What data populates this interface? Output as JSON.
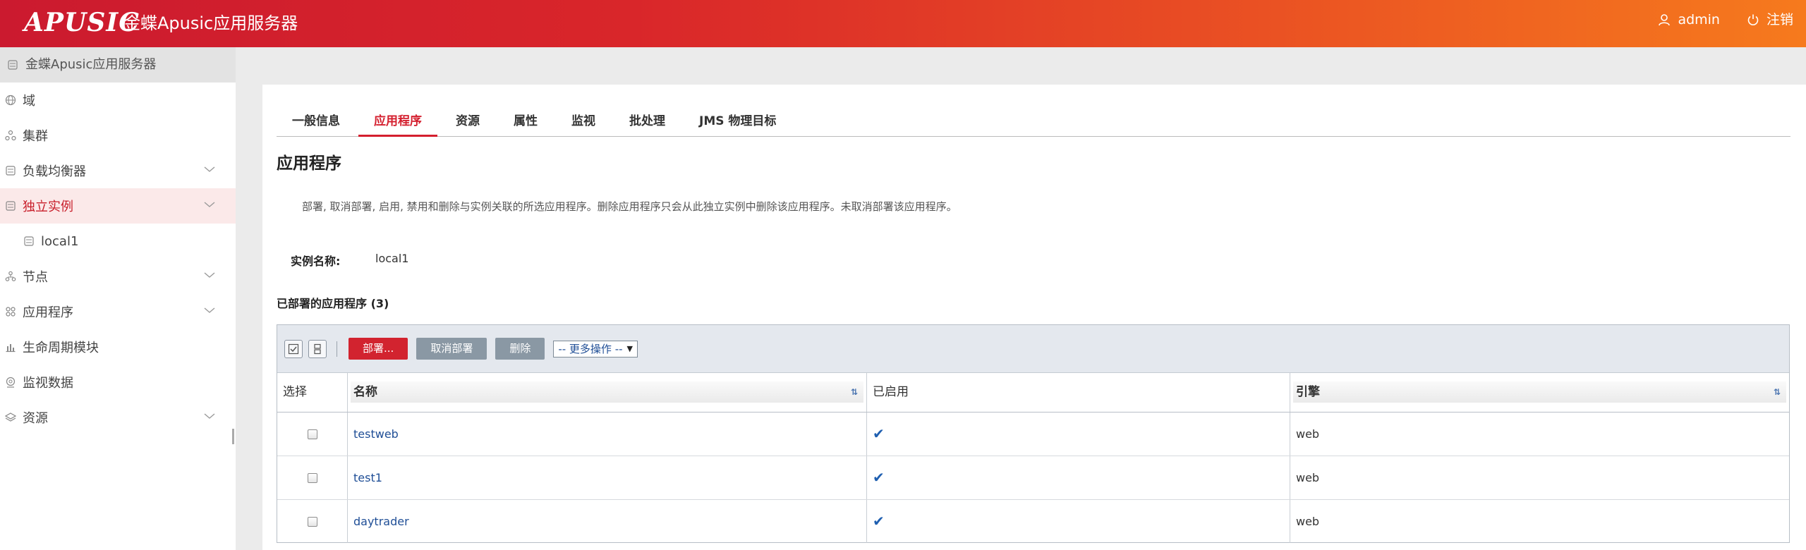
{
  "header": {
    "logo_text": "APUSIC",
    "product_name": "金蝶Apusic应用服务器",
    "user_name": "admin",
    "logout_label": "注销"
  },
  "sidebar": {
    "title": "金蝶Apusic应用服务器",
    "items": [
      {
        "label": "域",
        "icon": "globe-icon",
        "expandable": false
      },
      {
        "label": "集群",
        "icon": "cluster-icon",
        "expandable": false
      },
      {
        "label": "负载均衡器",
        "icon": "server-icon",
        "expandable": true
      },
      {
        "label": "独立实例",
        "icon": "server-icon",
        "expandable": true,
        "active": true
      },
      {
        "label": "local1",
        "icon": "server-icon",
        "expandable": false,
        "sub": true
      },
      {
        "label": "节点",
        "icon": "node-icon",
        "expandable": true
      },
      {
        "label": "应用程序",
        "icon": "apps-icon",
        "expandable": true
      },
      {
        "label": "生命周期模块",
        "icon": "bar-chart-icon",
        "expandable": false
      },
      {
        "label": "监视数据",
        "icon": "monitor-icon",
        "expandable": false
      },
      {
        "label": "资源",
        "icon": "layers-icon",
        "expandable": true
      }
    ]
  },
  "tabs": [
    {
      "label": "一般信息",
      "active": false
    },
    {
      "label": "应用程序",
      "active": true
    },
    {
      "label": "资源",
      "active": false
    },
    {
      "label": "属性",
      "active": false
    },
    {
      "label": "监视",
      "active": false
    },
    {
      "label": "批处理",
      "active": false
    },
    {
      "label": "JMS 物理目标",
      "active": false
    }
  ],
  "page": {
    "title": "应用程序",
    "description": "部署, 取消部署, 启用, 禁用和删除与实例关联的所选应用程序。删除应用程序只会从此独立实例中删除该应用程序。未取消部署该应用程序。",
    "instance_label": "实例名称:",
    "instance_value": "local1",
    "table_caption": "已部署的应用程序 (3)"
  },
  "toolbar": {
    "deploy_label": "部署...",
    "undeploy_label": "取消部署",
    "delete_label": "删除",
    "more_actions_label": "-- 更多操作 --"
  },
  "table": {
    "columns": [
      "选择",
      "名称",
      "已启用",
      "引擎"
    ],
    "rows": [
      {
        "name": "testweb",
        "enabled": "✔",
        "engine": "web"
      },
      {
        "name": "test1",
        "enabled": "✔",
        "engine": "web"
      },
      {
        "name": "daytrader",
        "enabled": "✔",
        "engine": "web"
      }
    ]
  },
  "colors": {
    "header_start": "#cb1a2f",
    "header_end": "#f67a1d",
    "accent": "#d41f2e",
    "link": "#1f4e96"
  }
}
